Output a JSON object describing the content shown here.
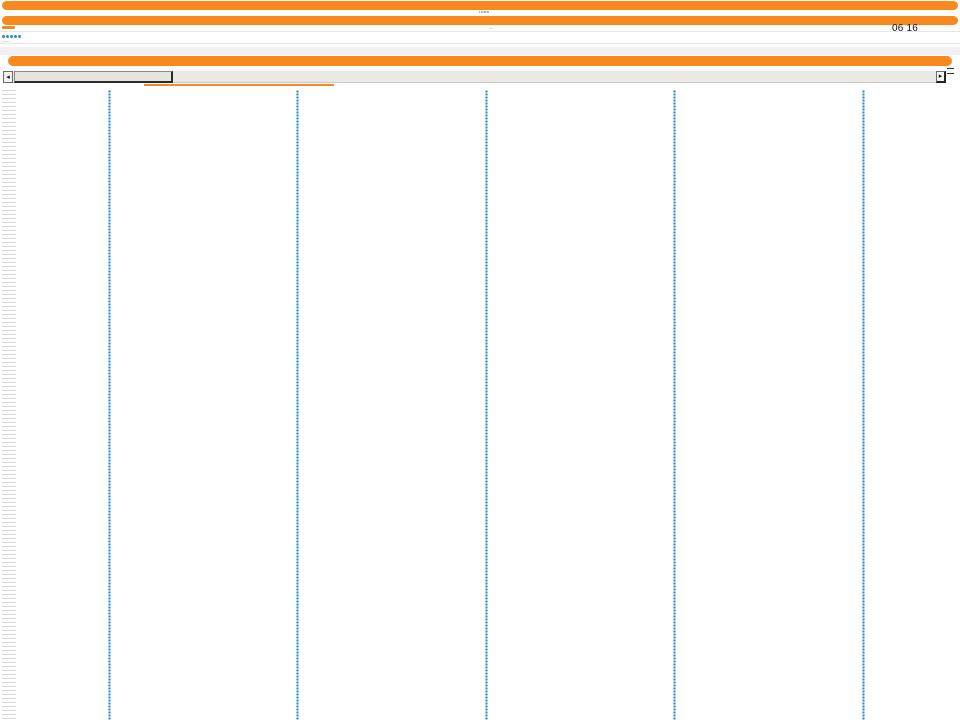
{
  "header": {
    "caption": "Linea",
    "sub_caption": "–"
  },
  "status": {
    "clock": "06 16"
  },
  "toolbar": {
    "dots_caption": "——"
  },
  "scrollbar": {
    "left_arrow": "◂",
    "right_arrow": "▸"
  },
  "tracks": {
    "count": 5
  },
  "colors": {
    "accent": "#f7891f",
    "track_dots": "#2a8fc7",
    "scrollbar_bg": "#ebe9e5"
  }
}
